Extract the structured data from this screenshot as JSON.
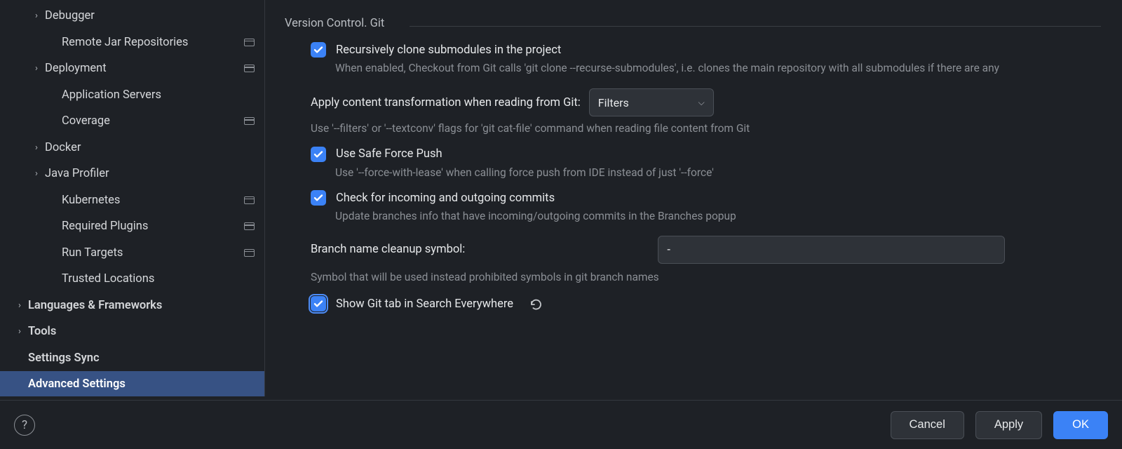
{
  "sidebar": {
    "items": [
      {
        "label": "Debugger",
        "indent": 2,
        "chevron": true,
        "persist": false,
        "bold": false
      },
      {
        "label": "Remote Jar Repositories",
        "indent": 3,
        "chevron": false,
        "persist": true,
        "bold": false
      },
      {
        "label": "Deployment",
        "indent": 2,
        "chevron": true,
        "persist": true,
        "bold": false
      },
      {
        "label": "Application Servers",
        "indent": 3,
        "chevron": false,
        "persist": false,
        "bold": false
      },
      {
        "label": "Coverage",
        "indent": 3,
        "chevron": false,
        "persist": true,
        "bold": false
      },
      {
        "label": "Docker",
        "indent": 2,
        "chevron": true,
        "persist": false,
        "bold": false
      },
      {
        "label": "Java Profiler",
        "indent": 2,
        "chevron": true,
        "persist": false,
        "bold": false
      },
      {
        "label": "Kubernetes",
        "indent": 3,
        "chevron": false,
        "persist": true,
        "bold": false
      },
      {
        "label": "Required Plugins",
        "indent": 3,
        "chevron": false,
        "persist": true,
        "bold": false
      },
      {
        "label": "Run Targets",
        "indent": 3,
        "chevron": false,
        "persist": true,
        "bold": false
      },
      {
        "label": "Trusted Locations",
        "indent": 3,
        "chevron": false,
        "persist": false,
        "bold": false
      },
      {
        "label": "Languages & Frameworks",
        "indent": 1,
        "chevron": true,
        "persist": false,
        "bold": true
      },
      {
        "label": "Tools",
        "indent": 1,
        "chevron": true,
        "persist": false,
        "bold": true
      },
      {
        "label": "Settings Sync",
        "indent": 1,
        "chevron": false,
        "persist": false,
        "bold": true
      },
      {
        "label": "Advanced Settings",
        "indent": 1,
        "chevron": false,
        "persist": false,
        "bold": true,
        "selected": true
      }
    ]
  },
  "section_title": "Version Control. Git",
  "settings": {
    "recursive": {
      "label": "Recursively clone submodules in the project",
      "hint": "When enabled, Checkout from Git calls 'git clone --recurse-submodules', i.e. clones the main repository with all submodules if there are any",
      "checked": true
    },
    "transform": {
      "label": "Apply content transformation when reading from Git:",
      "value": "Filters",
      "hint": "Use '--filters' or '--textconv' flags for 'git cat-file' command when reading file content from Git"
    },
    "safepush": {
      "label": "Use Safe Force Push",
      "hint": "Use '--force-with-lease' when calling force push from IDE instead of just '--force'",
      "checked": true
    },
    "checkcommits": {
      "label": "Check for incoming and outgoing commits",
      "hint": "Update branches info that have incoming/outgoing commits in the Branches popup",
      "checked": true
    },
    "branchcleanup": {
      "label": "Branch name cleanup symbol:",
      "value": "-",
      "hint": "Symbol that will be used instead prohibited symbols in git branch names"
    },
    "gittab": {
      "label": "Show Git tab in Search Everywhere",
      "checked": true
    }
  },
  "buttons": {
    "cancel": "Cancel",
    "apply": "Apply",
    "ok": "OK",
    "help": "?"
  }
}
